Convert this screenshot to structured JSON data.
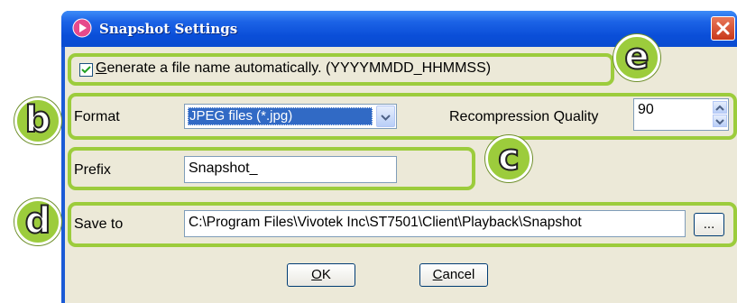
{
  "window": {
    "title": "Snapshot Settings"
  },
  "auto_name": {
    "checked": true,
    "label_accel": "G",
    "label_rest": "enerate a file name automatically. (YYYYMMDD_HHMMSS)"
  },
  "format": {
    "label": "Format",
    "selected": "JPEG files (*.jpg)",
    "quality_label": "Recompression Quality",
    "quality_value": "90"
  },
  "prefix": {
    "label": "Prefix",
    "value": "Snapshot_"
  },
  "save_to": {
    "label": "Save to",
    "value": "C:\\Program Files\\Vivotek Inc\\ST7501\\Client\\Playback\\Snapshot",
    "browse_label": "..."
  },
  "buttons": {
    "ok_accel": "O",
    "ok_rest": "K",
    "cancel_accel": "C",
    "cancel_rest": "ancel"
  },
  "callouts": {
    "b": "b",
    "c": "c",
    "d": "d",
    "e": "e"
  },
  "colors": {
    "highlight": "#9ccc3c",
    "title_bar": "#0a4ed8",
    "dialog_bg": "#ece9d8",
    "close": "#c8381a"
  },
  "icons": {
    "title": "app-icon",
    "close": "close-icon",
    "dropdown": "chevron-down-icon",
    "spin_up": "arrow-up-icon",
    "spin_down": "arrow-down-icon",
    "check": "checkmark-icon"
  }
}
